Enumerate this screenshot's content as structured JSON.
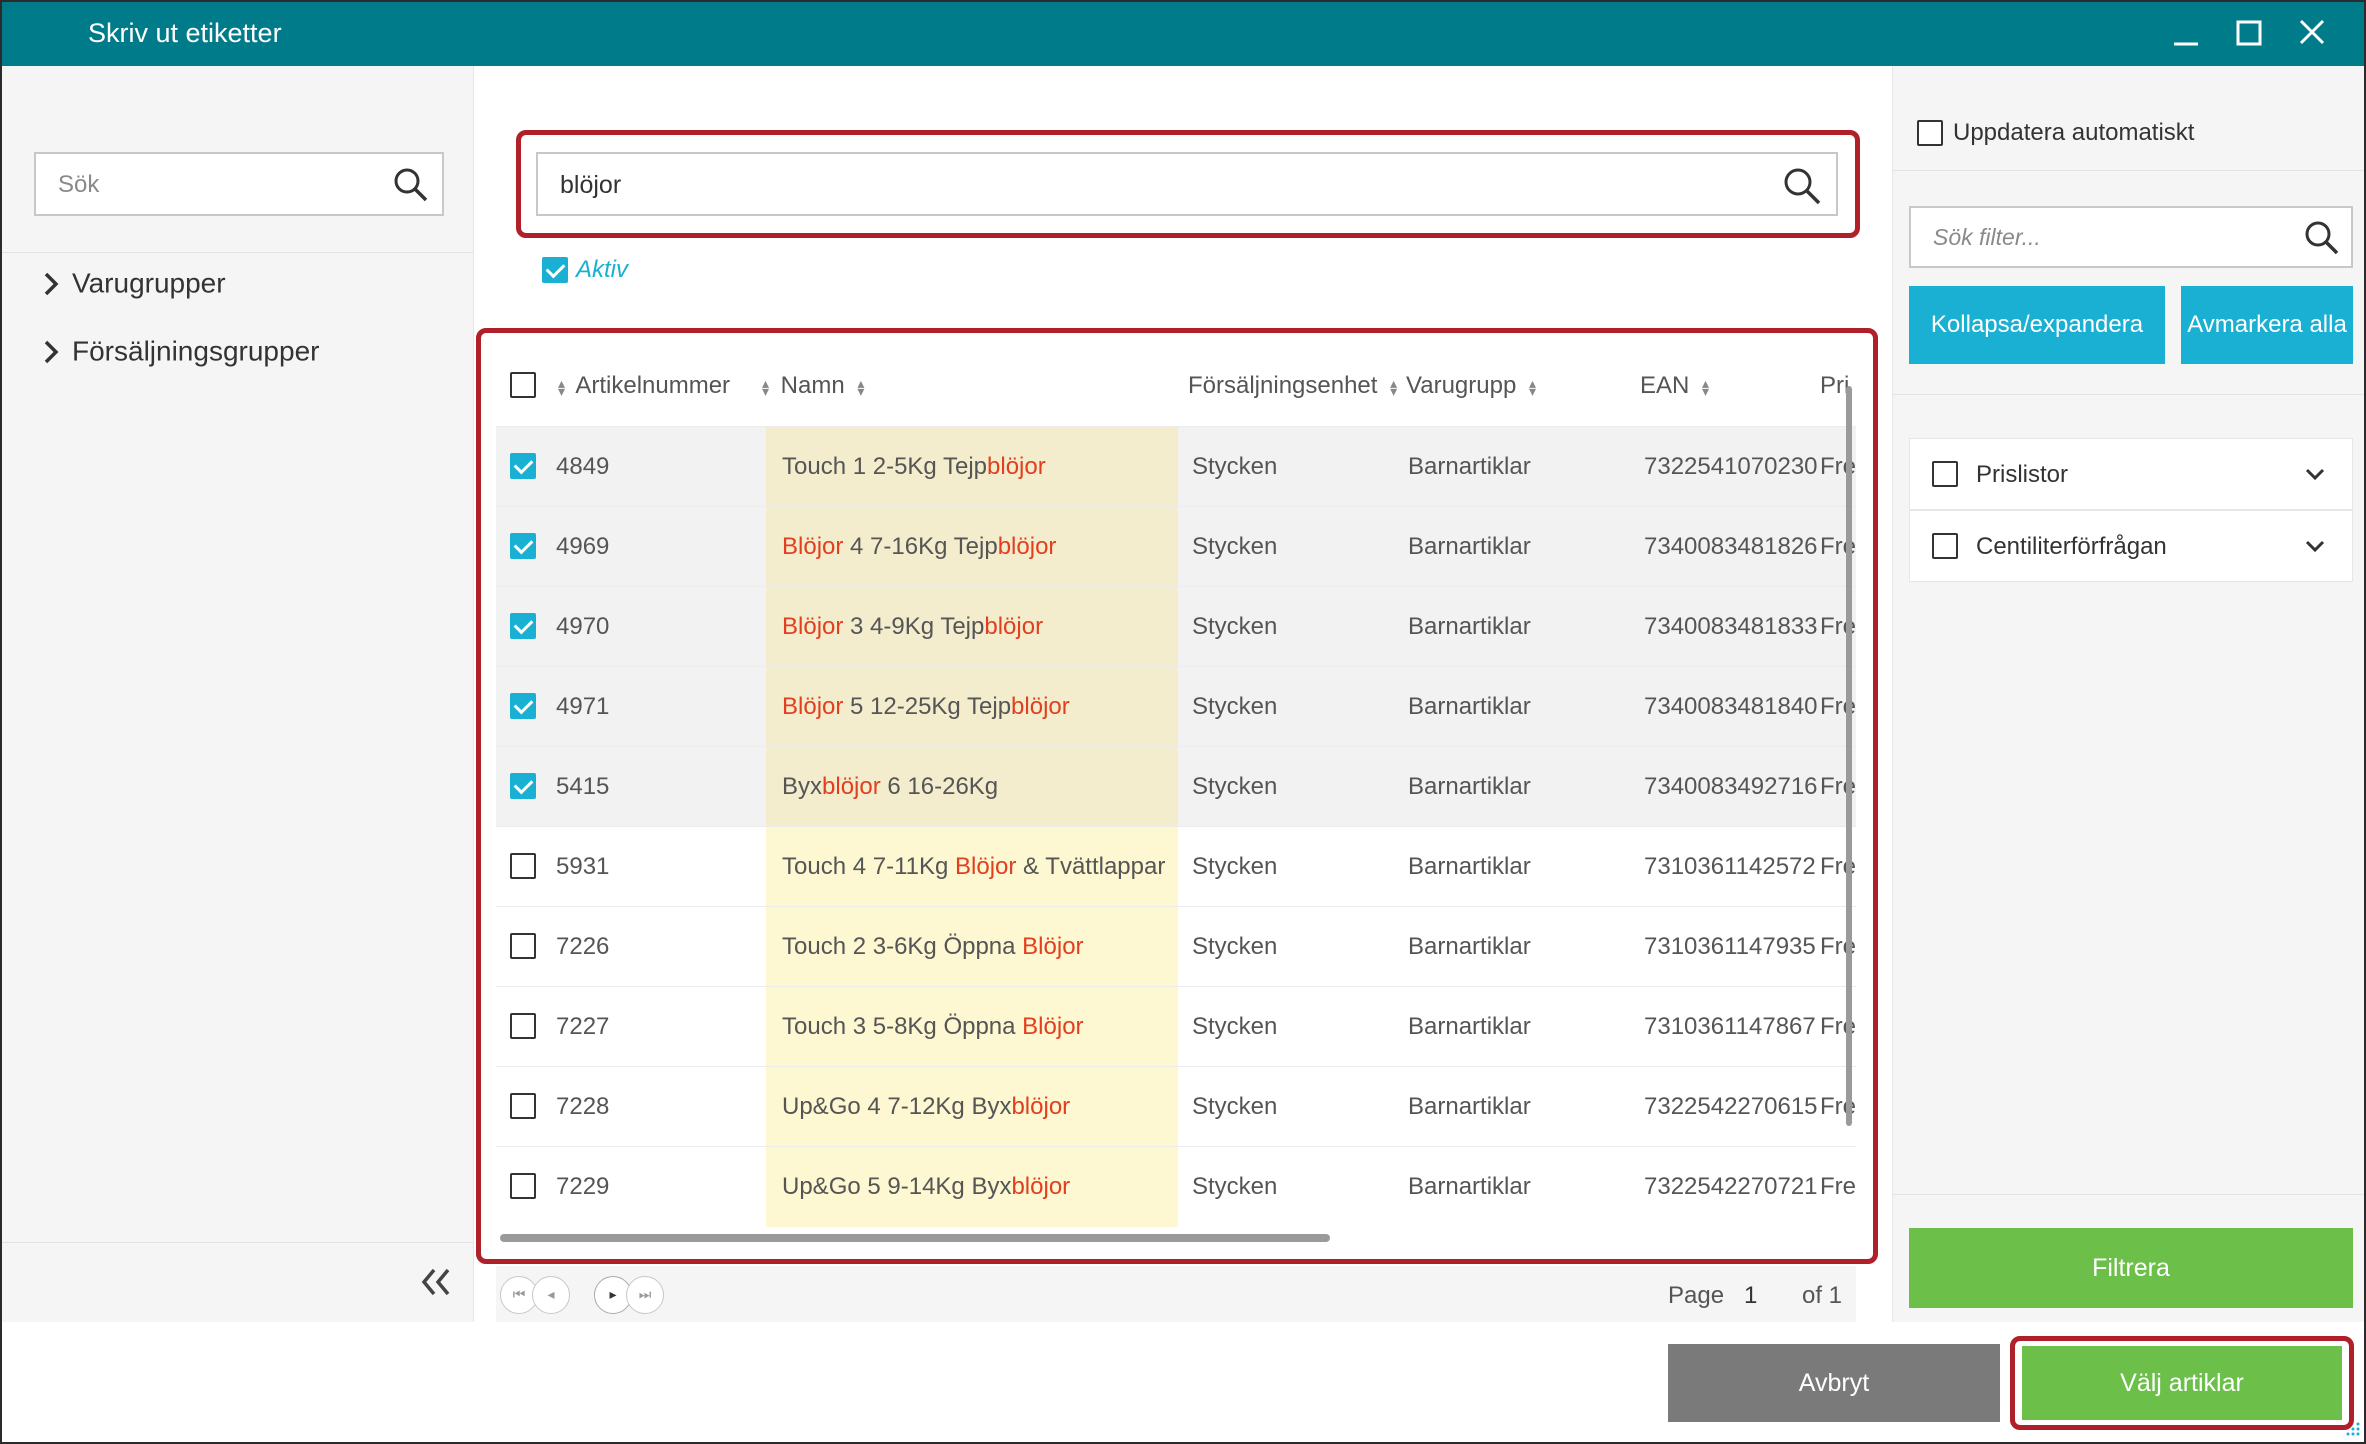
{
  "window": {
    "title": "Skriv ut etiketter",
    "minimize_icon": "minimize-icon",
    "maximize_icon": "maximize-icon",
    "close_icon": "close-icon"
  },
  "left_panel": {
    "search_placeholder": "Sök",
    "tree": [
      {
        "label": "Varugrupper"
      },
      {
        "label": "Försäljningsgrupper"
      }
    ]
  },
  "main": {
    "search_value": "blöjor",
    "aktiv_label": "Aktiv",
    "aktiv_checked": true,
    "columns": [
      "Artikelnummer",
      "Namn",
      "Försäljningsenhet",
      "Varugrupp",
      "EAN",
      "Pri"
    ],
    "rows": [
      {
        "checked": true,
        "artikel": "4849",
        "name_parts": [
          {
            "t": "Touch 1 2-5Kg Tejp",
            "h": false
          },
          {
            "t": "blöjor",
            "h": true
          }
        ],
        "enhet": "Stycken",
        "varugrupp": "Barnartiklar",
        "ean": "7322541070230",
        "pri": "Fre"
      },
      {
        "checked": true,
        "artikel": "4969",
        "name_parts": [
          {
            "t": "Blöjor",
            "h": true
          },
          {
            "t": " 4 7-16Kg Tejp",
            "h": false
          },
          {
            "t": "blöjor",
            "h": true
          }
        ],
        "enhet": "Stycken",
        "varugrupp": "Barnartiklar",
        "ean": "7340083481826",
        "pri": "Fre"
      },
      {
        "checked": true,
        "artikel": "4970",
        "name_parts": [
          {
            "t": "Blöjor",
            "h": true
          },
          {
            "t": " 3 4-9Kg Tejp",
            "h": false
          },
          {
            "t": "blöjor",
            "h": true
          }
        ],
        "enhet": "Stycken",
        "varugrupp": "Barnartiklar",
        "ean": "7340083481833",
        "pri": "Fre"
      },
      {
        "checked": true,
        "artikel": "4971",
        "name_parts": [
          {
            "t": "Blöjor",
            "h": true
          },
          {
            "t": " 5 12-25Kg Tejp",
            "h": false
          },
          {
            "t": "blöjor",
            "h": true
          }
        ],
        "enhet": "Stycken",
        "varugrupp": "Barnartiklar",
        "ean": "7340083481840",
        "pri": "Fre"
      },
      {
        "checked": true,
        "artikel": "5415",
        "name_parts": [
          {
            "t": "Byx",
            "h": false
          },
          {
            "t": "blöjor",
            "h": true
          },
          {
            "t": " 6 16-26Kg",
            "h": false
          }
        ],
        "enhet": "Stycken",
        "varugrupp": "Barnartiklar",
        "ean": "7340083492716",
        "pri": "Fre"
      },
      {
        "checked": false,
        "artikel": "5931",
        "name_parts": [
          {
            "t": "Touch 4 7-11Kg ",
            "h": false
          },
          {
            "t": "Blöjor",
            "h": true
          },
          {
            "t": " & Tvättlappar",
            "h": false
          }
        ],
        "enhet": "Stycken",
        "varugrupp": "Barnartiklar",
        "ean": "7310361142572",
        "pri": "Fre"
      },
      {
        "checked": false,
        "artikel": "7226",
        "name_parts": [
          {
            "t": "Touch 2 3-6Kg Öppna ",
            "h": false
          },
          {
            "t": "Blöjor",
            "h": true
          }
        ],
        "enhet": "Stycken",
        "varugrupp": "Barnartiklar",
        "ean": "7310361147935",
        "pri": "Fre"
      },
      {
        "checked": false,
        "artikel": "7227",
        "name_parts": [
          {
            "t": "Touch 3 5-8Kg Öppna ",
            "h": false
          },
          {
            "t": "Blöjor",
            "h": true
          }
        ],
        "enhet": "Stycken",
        "varugrupp": "Barnartiklar",
        "ean": "7310361147867",
        "pri": "Fre"
      },
      {
        "checked": false,
        "artikel": "7228",
        "name_parts": [
          {
            "t": "Up&Go 4 7-12Kg Byx",
            "h": false
          },
          {
            "t": "blöjor",
            "h": true
          }
        ],
        "enhet": "Stycken",
        "varugrupp": "Barnartiklar",
        "ean": "7322542270615",
        "pri": "Fre"
      },
      {
        "checked": false,
        "artikel": "7229",
        "name_parts": [
          {
            "t": "Up&Go 5 9-14Kg Byx",
            "h": false
          },
          {
            "t": "blöjor",
            "h": true
          }
        ],
        "enhet": "Stycken",
        "varugrupp": "Barnartiklar",
        "ean": "7322542270721",
        "pri": "Fre"
      }
    ],
    "pager": {
      "page_label": "Page",
      "page": "1",
      "of_label": "of 1"
    }
  },
  "right_panel": {
    "auto_update_label": "Uppdatera automatiskt",
    "filter_placeholder": "Sök filter...",
    "collapse_expand_label": "Kollapsa/expandera",
    "deselect_all_label": "Avmarkera alla",
    "filters": [
      {
        "label": "Prislistor"
      },
      {
        "label": "Centiliterförfrågan"
      }
    ],
    "filter_button": "Filtrera"
  },
  "footer": {
    "cancel_label": "Avbryt",
    "select_label": "Välj artiklar"
  },
  "colors": {
    "titlebar": "#007b8a",
    "accent": "#1ab0d3",
    "highlight_text": "#e0401f",
    "name_column_bg": "#fdf7d2",
    "green_button": "#6cc04a",
    "annotation_red": "#b02028"
  }
}
